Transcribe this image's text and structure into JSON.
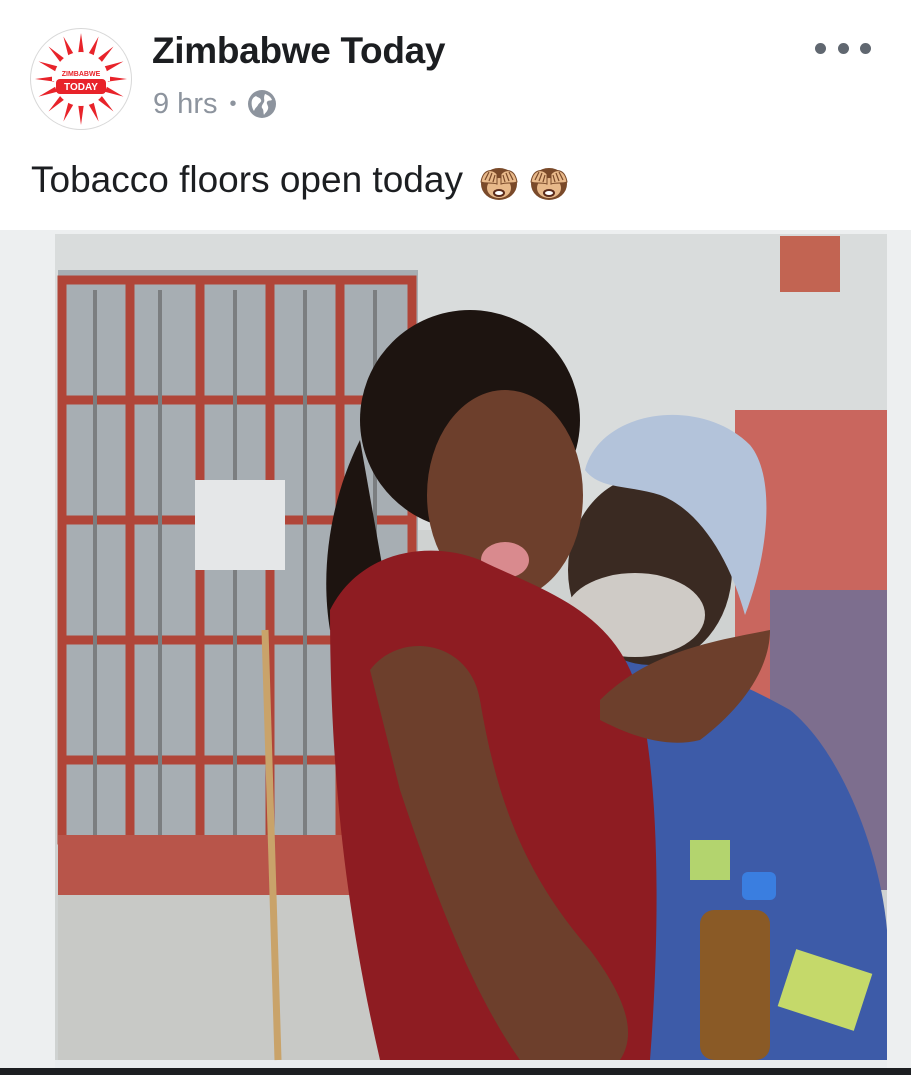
{
  "post": {
    "page_name": "Zimbabwe Today",
    "time": "9 hrs",
    "separator": "•",
    "privacy_icon": "globe-icon",
    "more_icon": "more-options-icon",
    "caption": "Tobacco floors open today",
    "caption_emoji": [
      "see-no-evil-monkey-emoji",
      "see-no-evil-monkey-emoji"
    ]
  },
  "avatar": {
    "line1": "ZIMBABWE",
    "line2": "TODAY",
    "brand_color": "#e8232a"
  },
  "colors": {
    "text_primary": "#1c1e21",
    "text_secondary": "#8d949e",
    "icon_gray": "#606770"
  }
}
